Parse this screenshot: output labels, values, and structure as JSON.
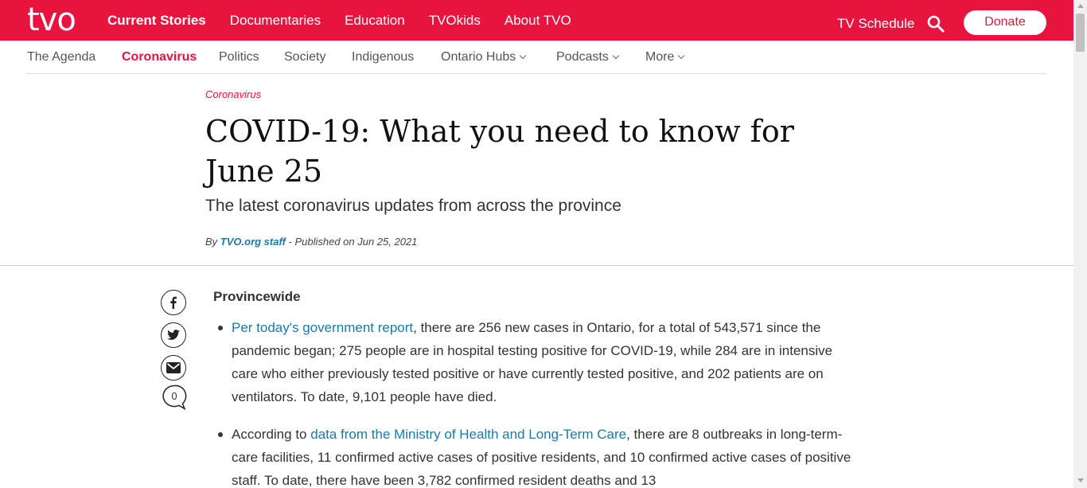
{
  "brand": {
    "logo": "tvo",
    "accent": "#e8143f",
    "link_color": "#1a7aa8"
  },
  "main_nav": [
    {
      "label": "Current Stories",
      "active": true
    },
    {
      "label": "Documentaries"
    },
    {
      "label": "Education"
    },
    {
      "label": "TVOkids"
    },
    {
      "label": "About TVO"
    }
  ],
  "header_right": {
    "tv_schedule": "TV Schedule",
    "search_icon": "search-icon",
    "donate": "Donate"
  },
  "sub_nav": [
    {
      "label": "The Agenda"
    },
    {
      "label": "Coronavirus",
      "active": true
    },
    {
      "label": "Politics"
    },
    {
      "label": "Society"
    },
    {
      "label": "Indigenous"
    },
    {
      "label": "Ontario Hubs",
      "dropdown": true
    },
    {
      "label": "Podcasts",
      "dropdown": true
    },
    {
      "label": "More",
      "dropdown": true
    }
  ],
  "article": {
    "category": "Coronavirus",
    "title": "COVID-19: What you need to know for June 25",
    "subtitle": "The latest coronavirus updates from across the province",
    "byline_prefix": "By ",
    "author": "TVO.org staff",
    "published": " - Published on Jun 25, 2021"
  },
  "share": {
    "comment_count": "0"
  },
  "body": {
    "heading": "Provincewide",
    "bullets": [
      {
        "link": "Per today's government report",
        "text": ", there are 256 new cases in Ontario, for a total of 543,571 since the pandemic began; 275 people are in hospital testing positive for COVID-19, while 284 are in intensive care who either previously tested positive or have currently tested positive, and 202 patients are on ventilators. To date, 9,101 people have died."
      },
      {
        "prefix": "According to ",
        "link": "data from the Ministry of Health and Long-Term Care",
        "text": ", there are 8 outbreaks in long-term-care facilities, 11 confirmed active cases of positive residents, and 10 confirmed active cases of positive staff. To date, there have been 3,782 confirmed resident deaths and 13"
      }
    ]
  }
}
